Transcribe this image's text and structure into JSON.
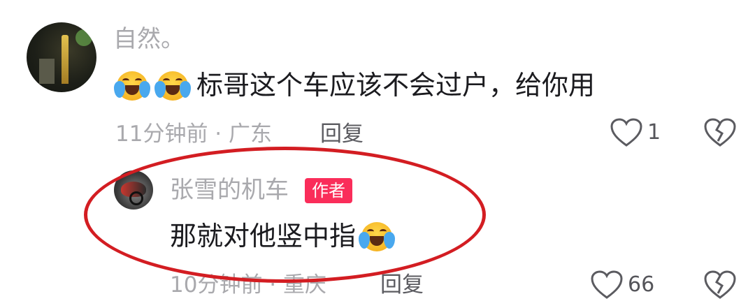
{
  "comment": {
    "username": "自然。",
    "text": "标哥这个车应该不会过户，给你用",
    "time_location": "11分钟前 · 广东",
    "reply_label": "回复",
    "like_count": "1",
    "emoji_count": 2
  },
  "reply": {
    "username": "张雪的机车",
    "author_badge": "作者",
    "text": "那就对他竖中指",
    "time_location": "10分钟前 · 重庆",
    "reply_label": "回复",
    "like_count": "66"
  },
  "colors": {
    "username": "#a9a9ad",
    "text": "#1b1b1f",
    "badge": "#fa2d5a",
    "highlight": "#d31d22"
  },
  "icons": [
    "heart-outline-icon",
    "broken-heart-icon",
    "crying-laughing-emoji"
  ]
}
